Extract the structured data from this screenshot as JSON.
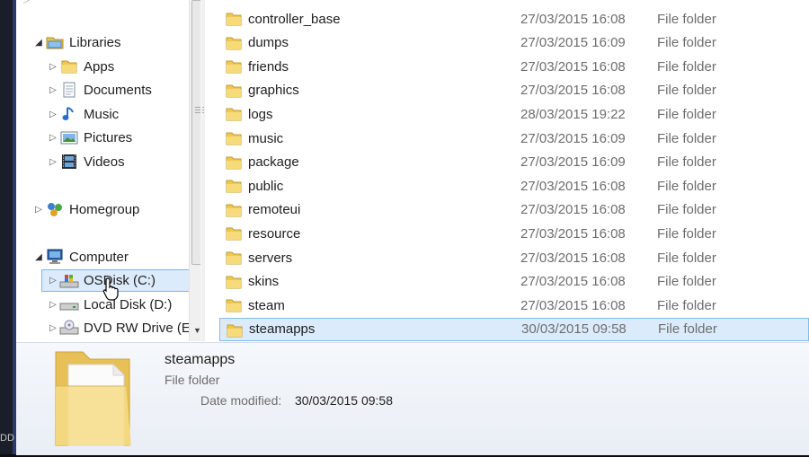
{
  "nav": {
    "items": [
      {
        "label": "Libraries",
        "level": 0,
        "expanded": true,
        "icon": "libraries-icon"
      },
      {
        "label": "Apps",
        "level": 1,
        "expanded": false,
        "icon": "folder-icon"
      },
      {
        "label": "Documents",
        "level": 1,
        "expanded": false,
        "icon": "documents-icon"
      },
      {
        "label": "Music",
        "level": 1,
        "expanded": false,
        "icon": "music-icon"
      },
      {
        "label": "Pictures",
        "level": 1,
        "expanded": false,
        "icon": "pictures-icon"
      },
      {
        "label": "Videos",
        "level": 1,
        "expanded": false,
        "icon": "videos-icon"
      },
      {
        "label": "Homegroup",
        "level": 0,
        "expanded": false,
        "icon": "homegroup-icon"
      },
      {
        "label": "Computer",
        "level": 0,
        "expanded": true,
        "icon": "computer-icon"
      },
      {
        "label": "OSDisk (C:)",
        "level": 1,
        "expanded": false,
        "icon": "os-drive-icon",
        "selected": true
      },
      {
        "label": "Local Disk (D:)",
        "level": 1,
        "expanded": false,
        "icon": "hard-drive-icon"
      },
      {
        "label": "DVD RW Drive (E:",
        "level": 1,
        "expanded": false,
        "icon": "dvd-drive-icon"
      }
    ]
  },
  "files": [
    {
      "name": "controller_base",
      "date": "27/03/2015 16:08",
      "type": "File folder"
    },
    {
      "name": "dumps",
      "date": "27/03/2015 16:09",
      "type": "File folder"
    },
    {
      "name": "friends",
      "date": "27/03/2015 16:08",
      "type": "File folder"
    },
    {
      "name": "graphics",
      "date": "27/03/2015 16:08",
      "type": "File folder"
    },
    {
      "name": "logs",
      "date": "28/03/2015 19:22",
      "type": "File folder"
    },
    {
      "name": "music",
      "date": "27/03/2015 16:09",
      "type": "File folder"
    },
    {
      "name": "package",
      "date": "27/03/2015 16:09",
      "type": "File folder"
    },
    {
      "name": "public",
      "date": "27/03/2015 16:08",
      "type": "File folder"
    },
    {
      "name": "remoteui",
      "date": "27/03/2015 16:08",
      "type": "File folder"
    },
    {
      "name": "resource",
      "date": "27/03/2015 16:08",
      "type": "File folder"
    },
    {
      "name": "servers",
      "date": "27/03/2015 16:08",
      "type": "File folder"
    },
    {
      "name": "skins",
      "date": "27/03/2015 16:08",
      "type": "File folder"
    },
    {
      "name": "steam",
      "date": "27/03/2015 16:08",
      "type": "File folder"
    },
    {
      "name": "steamapps",
      "date": "30/03/2015 09:58",
      "type": "File folder",
      "selected": true
    }
  ],
  "details": {
    "name": "steamapps",
    "type": "File folder",
    "modified_label": "Date modified:",
    "modified_value": "30/03/2015 09:58"
  },
  "left_edge_text": "DD",
  "colors": {
    "selection_bg": "#dcebfb",
    "selection_border": "#84bbe9",
    "folder_yellow": "#f3cf5a"
  }
}
